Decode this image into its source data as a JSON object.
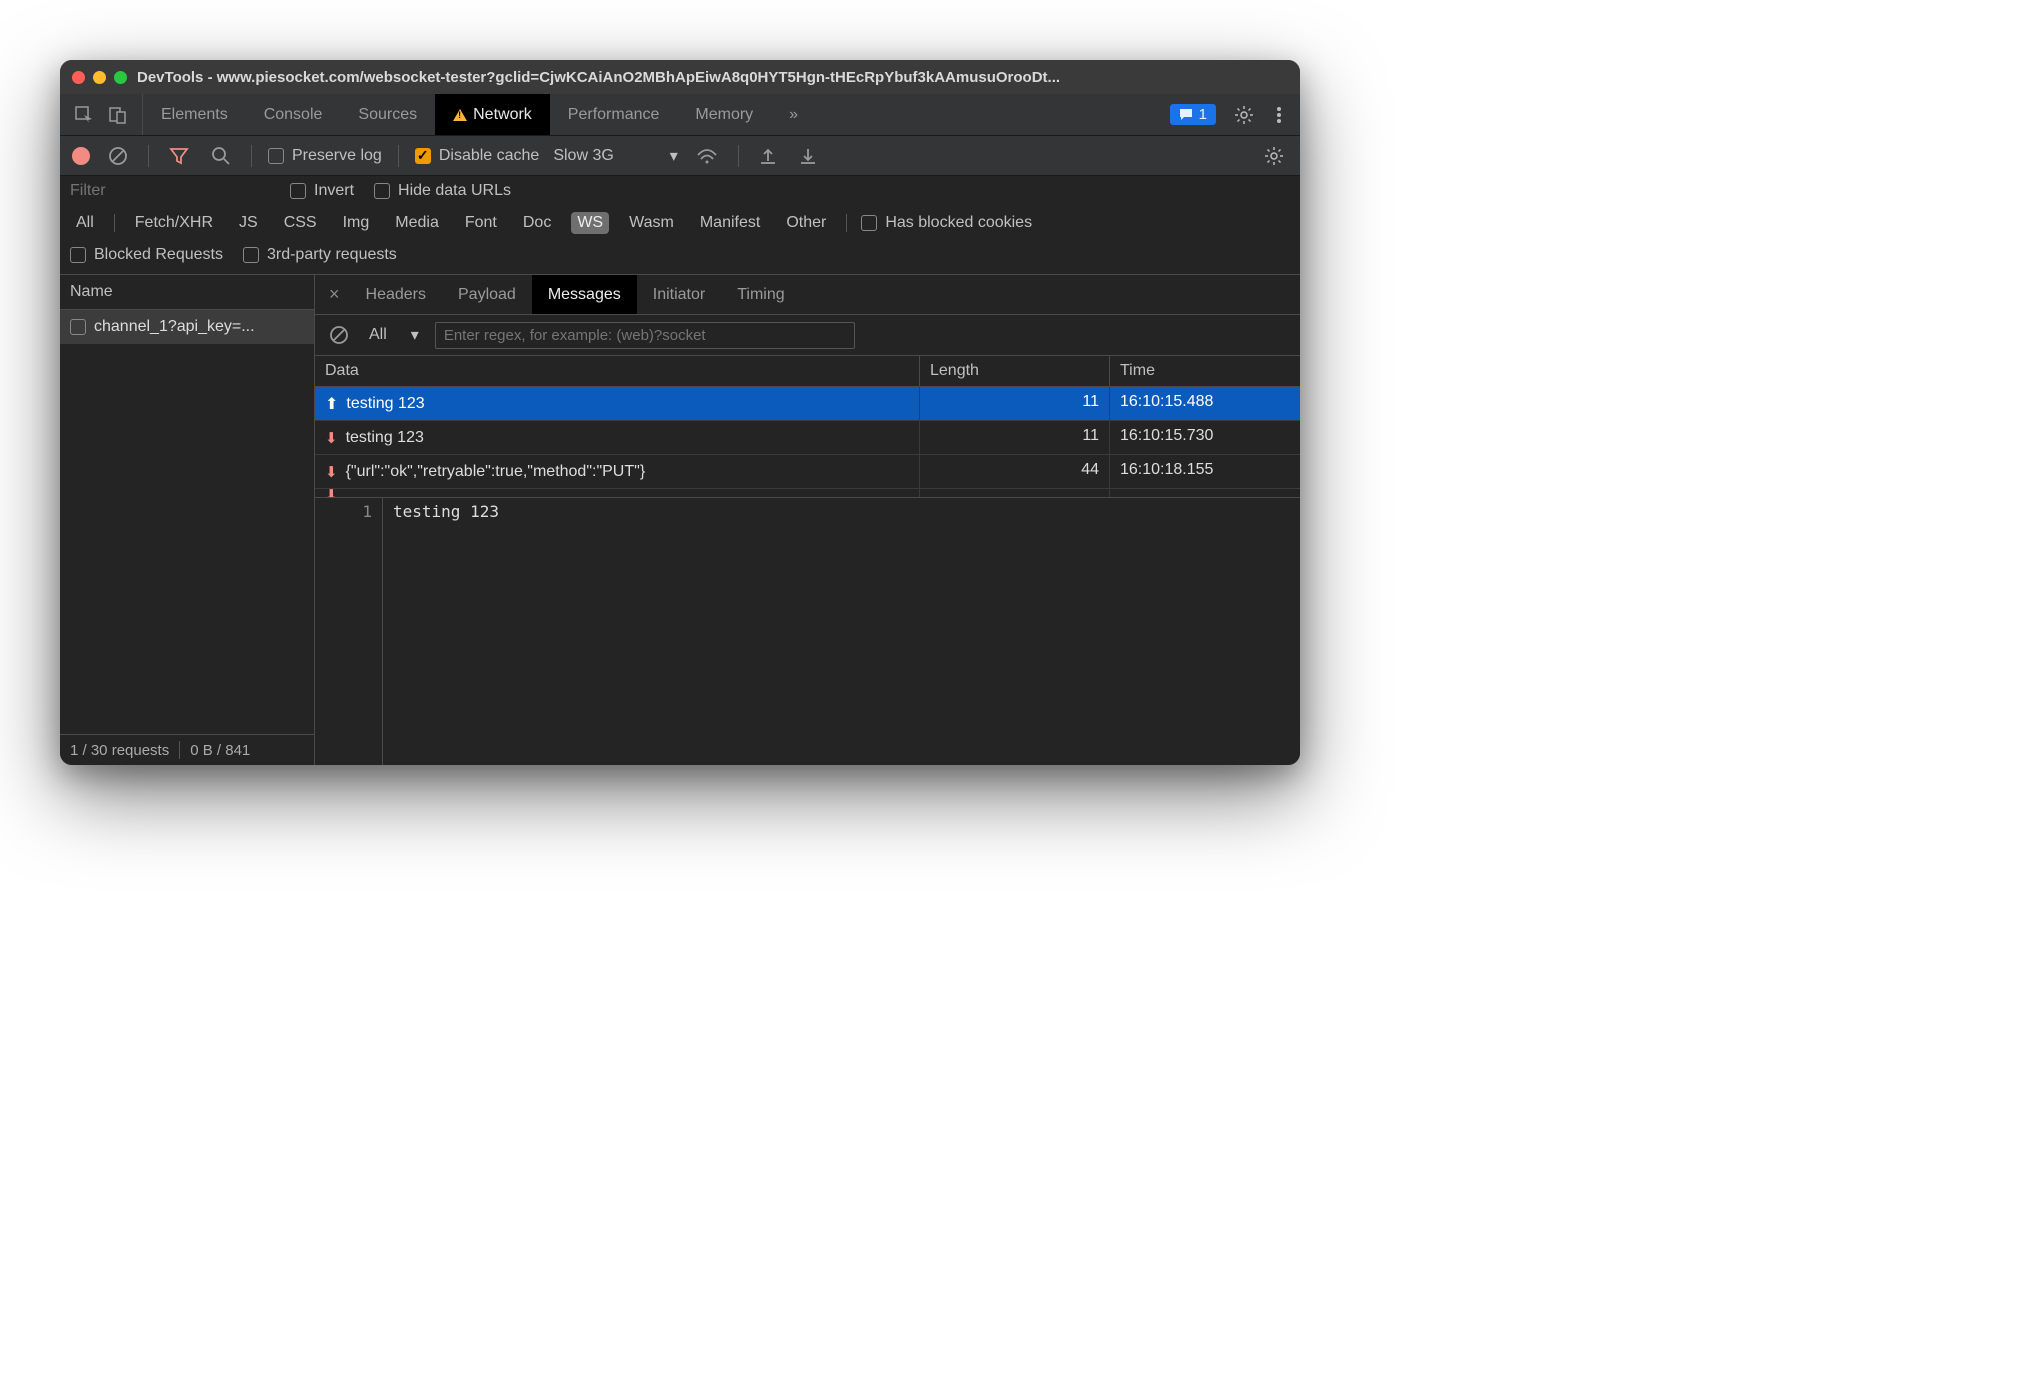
{
  "window": {
    "title": "DevTools - www.piesocket.com/websocket-tester?gclid=CjwKCAiAnO2MBhApEiwA8q0HYT5Hgn-tHEcRpYbuf3kAAmusuOrooDt..."
  },
  "tabs": {
    "items": [
      "Elements",
      "Console",
      "Sources",
      "Network",
      "Performance",
      "Memory"
    ],
    "active": "Network",
    "badge_count": "1"
  },
  "toolbar": {
    "preserve_log": "Preserve log",
    "disable_cache": "Disable cache",
    "throttling": "Slow 3G"
  },
  "filterbar": {
    "filter_placeholder": "Filter",
    "invert": "Invert",
    "hide_data_urls": "Hide data URLs"
  },
  "types": {
    "all": "All",
    "items": [
      "Fetch/XHR",
      "JS",
      "CSS",
      "Img",
      "Media",
      "Font",
      "Doc",
      "WS",
      "Wasm",
      "Manifest",
      "Other"
    ],
    "selected": "WS",
    "has_blocked": "Has blocked cookies"
  },
  "blocked": {
    "blocked_requests": "Blocked Requests",
    "third_party": "3rd-party requests"
  },
  "left": {
    "header": "Name",
    "request": "channel_1?api_key=...",
    "footer_requests": "1 / 30 requests",
    "footer_bytes": "0 B / 841"
  },
  "detail": {
    "tabs": [
      "Headers",
      "Payload",
      "Messages",
      "Initiator",
      "Timing"
    ],
    "active": "Messages",
    "filter_all": "All",
    "regex_placeholder": "Enter regex, for example: (web)?socket"
  },
  "messages": {
    "headers": {
      "data": "Data",
      "length": "Length",
      "time": "Time"
    },
    "rows": [
      {
        "dir": "up",
        "data": "testing 123",
        "length": "11",
        "time": "16:10:15.488",
        "selected": true
      },
      {
        "dir": "down",
        "data": "testing 123",
        "length": "11",
        "time": "16:10:15.730",
        "selected": false
      },
      {
        "dir": "down",
        "data": "{\"url\":\"ok\",\"retryable\":true,\"method\":\"PUT\"}",
        "length": "44",
        "time": "16:10:18.155",
        "selected": false
      }
    ]
  },
  "preview": {
    "line_no": "1",
    "content": "testing 123"
  }
}
